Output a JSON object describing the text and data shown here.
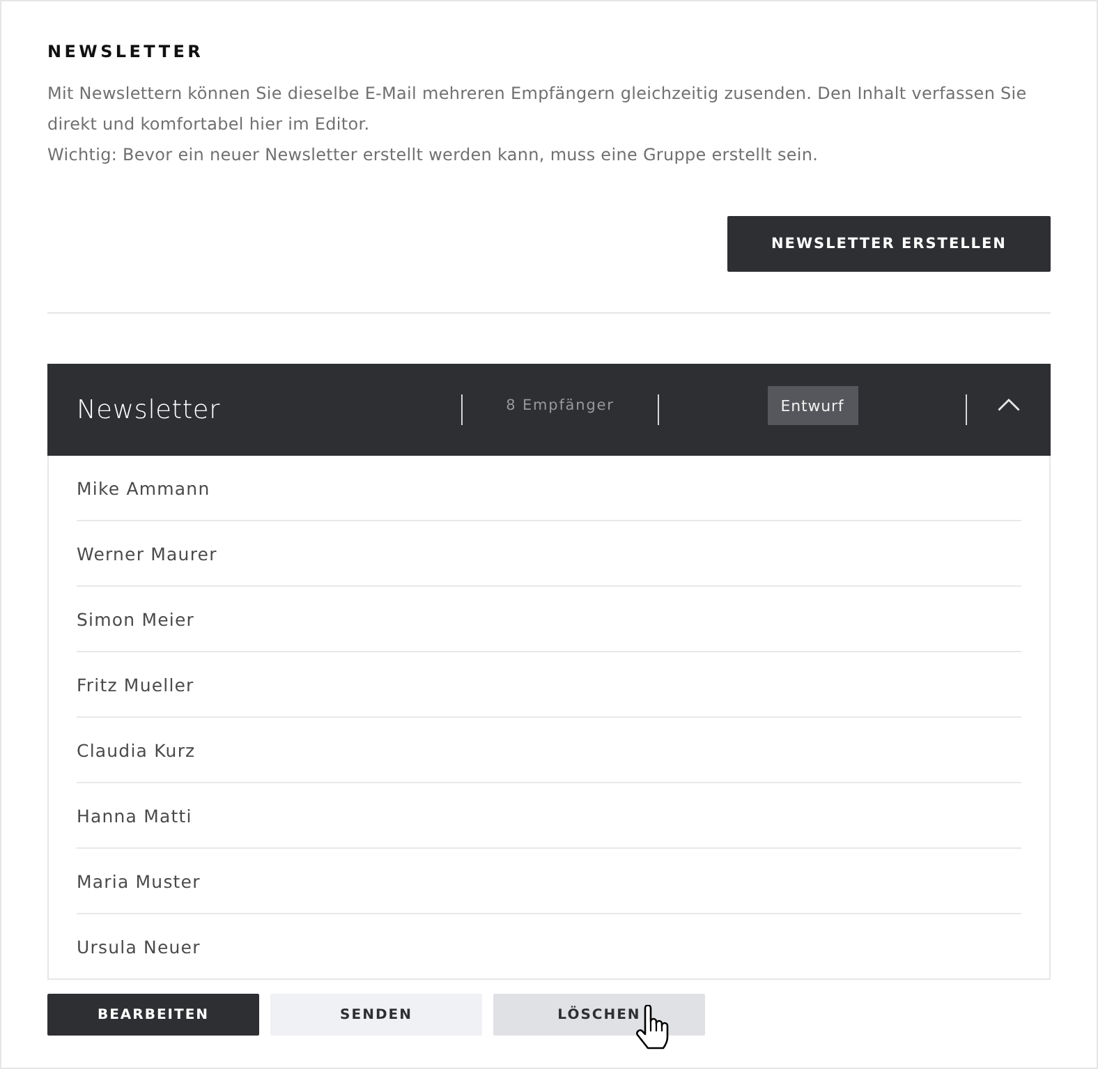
{
  "section": {
    "heading": "NEWSLETTER",
    "paragraphs": [
      "Mit Newslettern können Sie dieselbe E-Mail mehreren Empfängern gleichzeitig zusenden. Den Inhalt verfassen Sie direkt und komfortabel hier im Editor.",
      "Wichtig: Bevor ein neuer Newsletter erstellt werden kann, muss eine Gruppe erstellt sein."
    ],
    "create_button": "NEWSLETTER ERSTELLEN"
  },
  "panel": {
    "title": "Newsletter",
    "recipient_count": "8 Empfänger",
    "status": "Entwurf",
    "expanded": true,
    "recipients": [
      "Mike Ammann",
      "Werner Maurer",
      "Simon Meier",
      "Fritz Mueller",
      "Claudia Kurz",
      "Hanna Matti",
      "Maria Muster",
      "Ursula Neuer"
    ]
  },
  "actions": [
    {
      "label": "BEARBEITEN",
      "kind": "primary",
      "hovered": false
    },
    {
      "label": "SENDEN",
      "kind": "secondary",
      "hovered": false
    },
    {
      "label": "LÖSCHEN",
      "kind": "secondary",
      "hovered": true
    }
  ]
}
